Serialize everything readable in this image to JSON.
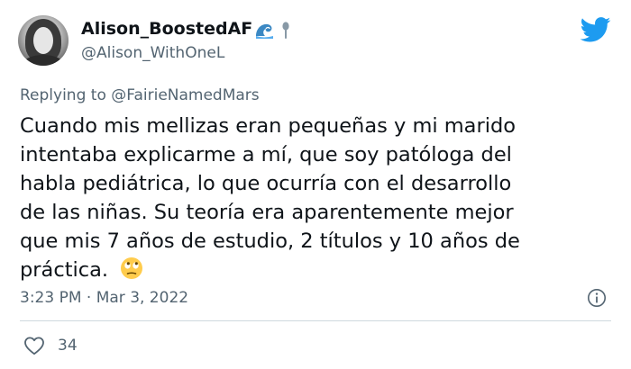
{
  "user": {
    "display_name": "Alison_BoostedAF",
    "handle": "@Alison_WithOneL",
    "name_emoji_icons": [
      "wave-icon",
      "spoon-icon"
    ],
    "avatar": "avatar-photo"
  },
  "reply": {
    "prefix": "Replying to",
    "target": "@FairieNamedMars"
  },
  "tweet": {
    "lines": [
      "Cuando mis mellizas eran pequeñas y mi marido",
      "intentaba explicarme a mí, que soy patóloga del",
      "habla pediátrica, lo que ocurría con el desarrollo",
      "de las niñas. Su teoría era aparentemente mejor",
      "que mis 7 años de estudio, 2 títulos y 10 años de",
      "práctica."
    ],
    "trailing_emoji": "face-with-rolling-eyes-icon"
  },
  "meta": {
    "timestamp": "3:23 PM · Mar 3, 2022"
  },
  "actions": {
    "like_count": "34"
  },
  "colors": {
    "brand": "#1d9bf0",
    "text_primary": "#0f1419",
    "text_secondary": "#536471",
    "divider": "#cfd9de"
  },
  "icons": {
    "brand_logo": "twitter-bird-icon",
    "info": "info-icon",
    "like": "heart-icon"
  }
}
